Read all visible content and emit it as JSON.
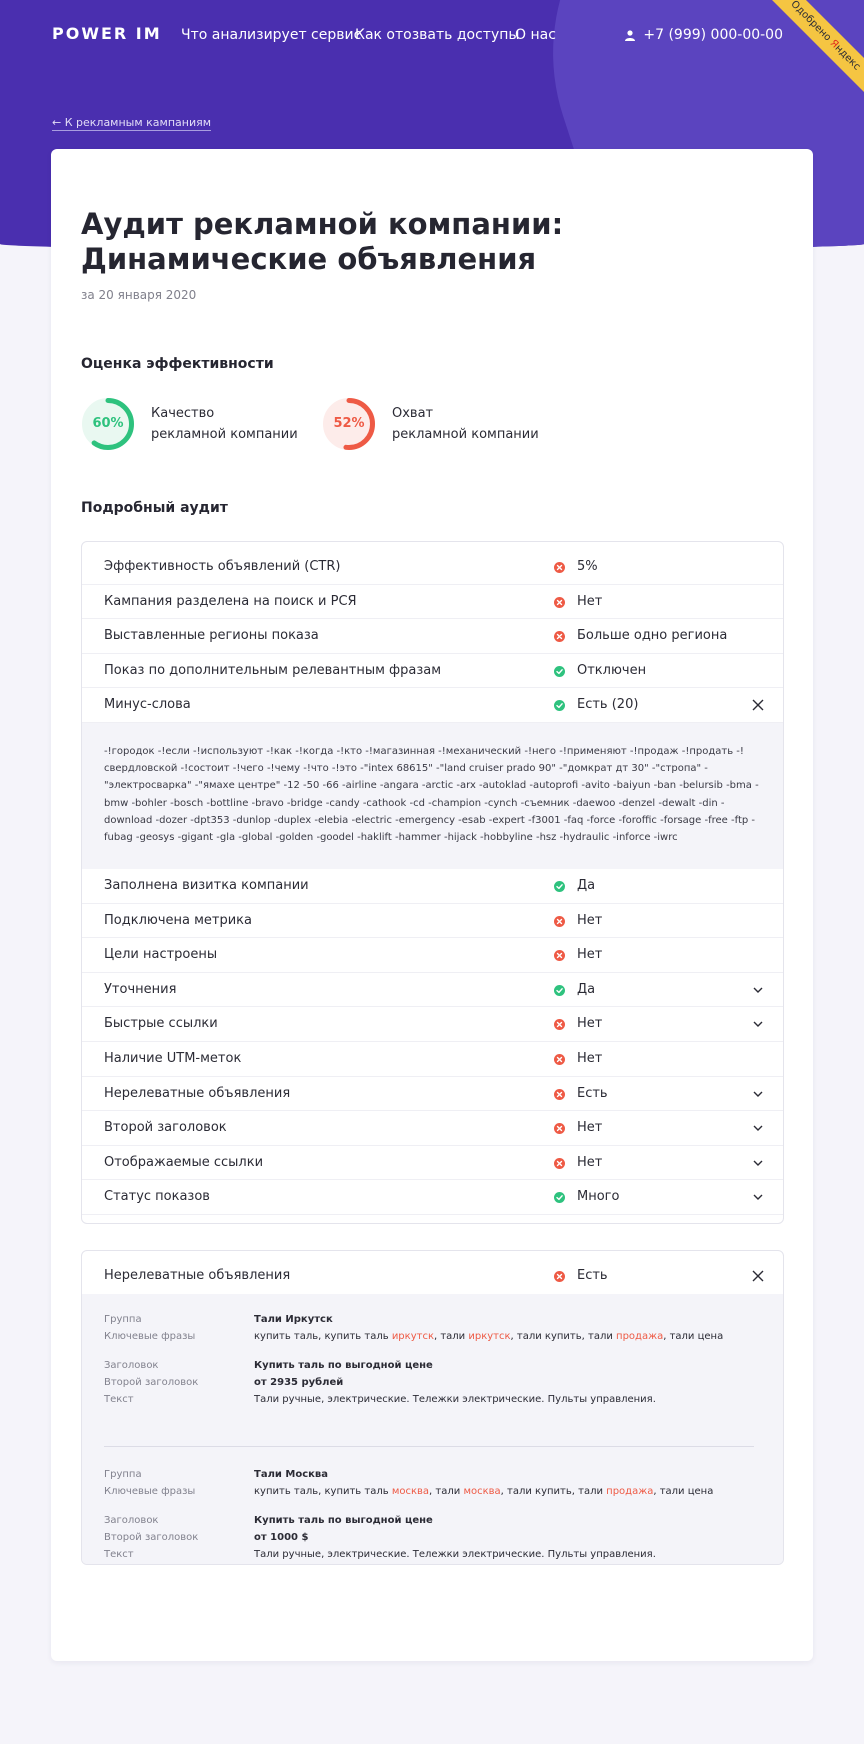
{
  "header": {
    "logo": "POWER IM",
    "nav": [
      "Что анализирует сервис",
      "Как отозвать доступы",
      "О нас"
    ],
    "phone": "+7 (999) 000-00-00",
    "ribbon_pre": "Одобрено ",
    "ribbon_y": "Я",
    "ribbon_post": "ндекс"
  },
  "back_link": "← К рекламным кампаниям",
  "page": {
    "title": "Аудит рекламной компании: Динамические объявления",
    "date": "за 20 января 2020"
  },
  "efficiency": {
    "heading": "Оценка эффективности",
    "scores": [
      {
        "value": "60%",
        "fraction": 0.6,
        "line1": "Качество",
        "line2": "рекламной компании",
        "color": "#2ec27e",
        "track": "#e9f8f1"
      },
      {
        "value": "52%",
        "fraction": 0.52,
        "line1": "Охват",
        "line2": "рекламной компании",
        "color": "#ee5a45",
        "track": "#fdecea"
      }
    ]
  },
  "audit": {
    "heading": "Подробный аудит",
    "rows_top": [
      {
        "name": "Эффективность объявлений (CTR)",
        "status": "bad",
        "value": "5%"
      },
      {
        "name": "Кампания разделена на поиск и РСЯ",
        "status": "bad",
        "value": "Нет"
      },
      {
        "name": "Выставленные регионы показа",
        "status": "bad",
        "value": "Больше одно региона"
      },
      {
        "name": "Показ по дополнительным релевантным фразам",
        "status": "ok",
        "value": "Отключен"
      },
      {
        "name": "Минус-слова",
        "status": "ok",
        "value": "Есть (20)"
      }
    ],
    "minus_words": "-!городок -!если -!используют -!как -!когда -!кто -!магазинная -!механический -!него -!применяют -!продаж -!продать -!свердловской -!состоит -!чего -!чему -!что -!это -\"intex 68615\" -\"land cruiser prado 90\" -\"домкрат дт 30\" -\"стропа\" -\"электросварка\" -\"ямахе центре\" -12 -50 -66 -airline -angara -arctic -arx -autoklad -autoprofi -avito -baiyun -ban -belursib -bma -bmw -bohler -bosch -bottline -bravo -bridge -candy -cathook -cd -champion -cynch -съемник -daewoo -denzel -dewalt -din -download -dozer -dpt353 -dunlop -duplex -elebia -electric -emergency -esab -expert -f3001 -faq -force -foroffic -forsage -free -ftp -fubag -geosys -gigant -gla -global -golden -goodel -haklift -hammer -hijack -hobbyline -hsz -hydraulic -inforce -iwrc",
    "rows_bottom": [
      {
        "name": "Заполнена визитка компании",
        "status": "ok",
        "value": "Да",
        "chevron": false
      },
      {
        "name": "Подключена метрика",
        "status": "bad",
        "value": "Нет",
        "chevron": false
      },
      {
        "name": "Цели настроены",
        "status": "bad",
        "value": "Нет",
        "chevron": false
      },
      {
        "name": "Уточнения",
        "status": "ok",
        "value": "Да",
        "chevron": true
      },
      {
        "name": "Быстрые ссылки",
        "status": "bad",
        "value": "Нет",
        "chevron": true
      },
      {
        "name": "Наличие UTM-меток",
        "status": "bad",
        "value": "Нет",
        "chevron": false
      },
      {
        "name": "Нерелеватные объявления",
        "status": "bad",
        "value": "Есть",
        "chevron": true
      },
      {
        "name": "Второй заголовок",
        "status": "bad",
        "value": "Нет",
        "chevron": true
      },
      {
        "name": "Отображаемые ссылки",
        "status": "bad",
        "value": "Нет",
        "chevron": true
      },
      {
        "name": "Статус показов",
        "status": "ok",
        "value": "Много",
        "chevron": true
      }
    ]
  },
  "irrelevant": {
    "name": "Нерелеватные объявления",
    "value": "Есть",
    "labels": {
      "group": "Группа",
      "keywords": "Ключевые фразы",
      "headline": "Заголовок",
      "headline2": "Второй заголовок",
      "text": "Текст"
    },
    "ads": [
      {
        "group": "Тали Иркутск",
        "keywords": [
          {
            "t": "купить таль, купить таль ",
            "h": false
          },
          {
            "t": "иркутск",
            "h": true
          },
          {
            "t": ", тали ",
            "h": false
          },
          {
            "t": "иркутск",
            "h": true
          },
          {
            "t": ", тали купить, тали ",
            "h": false
          },
          {
            "t": "продажа",
            "h": true
          },
          {
            "t": ", тали цена",
            "h": false
          }
        ],
        "headline": "Купить таль по выгодной цене",
        "headline2": "от 2935 рублей",
        "text": "Тали ручные, электрические. Тележки электрические. Пульты управления."
      },
      {
        "group": "Тали Москва",
        "keywords": [
          {
            "t": "купить таль, купить таль ",
            "h": false
          },
          {
            "t": "москва",
            "h": true
          },
          {
            "t": ", тали ",
            "h": false
          },
          {
            "t": "москва",
            "h": true
          },
          {
            "t": ", тали купить, тали ",
            "h": false
          },
          {
            "t": "продажа",
            "h": true
          },
          {
            "t": ", тали цена",
            "h": false
          }
        ],
        "headline": "Купить таль по выгодной цене",
        "headline2": "от 1000 $",
        "text": "Тали ручные, электрические. Тележки электрические. Пульты управления."
      }
    ]
  },
  "colors": {
    "ok": "#2ec27e",
    "bad": "#ee5a45",
    "brand": "#4a2faf"
  }
}
